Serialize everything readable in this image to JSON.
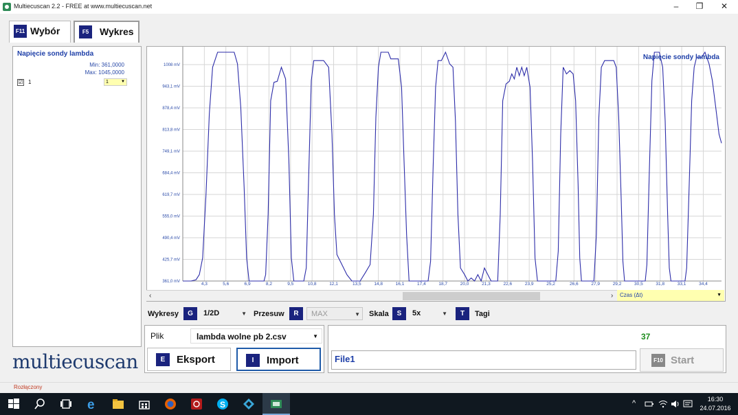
{
  "titlebar": {
    "title": "Multiecuscan 2.2 - FREE at www.multiecuscan.net",
    "minimize": "–",
    "maximize": "❐",
    "close": "✕"
  },
  "tabs": [
    {
      "key": "F11",
      "label": "Wybór"
    },
    {
      "key": "F5",
      "label": "Wykres"
    }
  ],
  "left_panel": {
    "title": "Napięcie sondy lambda",
    "min": "Min: 361,0000",
    "max": "Max: 1045,0000",
    "channel_checked": "☑",
    "channel_label": "1",
    "channel_select": "1"
  },
  "logo": "multiecuscan",
  "chart_data": {
    "type": "line",
    "title": "Napięcie sondy lambda",
    "y_ticks": [
      "361,0 mV",
      "425,7 mV",
      "490,4 mV",
      "555,0 mV",
      "619,7 mV",
      "684,4 mV",
      "749,1 mV",
      "813,8 mV",
      "878,4 mV",
      "943,1 mV",
      "1008 mV"
    ],
    "x_ticks": [
      "4,3",
      "5,6",
      "6,9",
      "8,2",
      "9,5",
      "10,8",
      "12,1",
      "13,5",
      "14,8",
      "16,1",
      "17,4",
      "18,7",
      "20,0",
      "21,3",
      "22,6",
      "23,9",
      "25,2",
      "26,6",
      "27,9",
      "29,2",
      "30,5",
      "31,8",
      "33,1",
      "34,4"
    ],
    "xlim": [
      3.0,
      35.5
    ],
    "ylim": [
      361,
      1008
    ],
    "grid": true,
    "series": [
      {
        "name": "Napięcie sondy lambda",
        "color": "#2b2ba8",
        "points": [
          [
            3.0,
            361
          ],
          [
            3.5,
            361
          ],
          [
            3.8,
            365
          ],
          [
            4.0,
            380
          ],
          [
            4.2,
            430
          ],
          [
            4.4,
            620
          ],
          [
            4.6,
            860
          ],
          [
            4.8,
            1000
          ],
          [
            5.1,
            1045
          ],
          [
            5.6,
            1045
          ],
          [
            6.1,
            1045
          ],
          [
            6.3,
            1010
          ],
          [
            6.5,
            880
          ],
          [
            6.7,
            640
          ],
          [
            6.85,
            430
          ],
          [
            7.0,
            361
          ],
          [
            7.5,
            361
          ],
          [
            7.9,
            361
          ],
          [
            8.0,
            380
          ],
          [
            8.15,
            560
          ],
          [
            8.3,
            900
          ],
          [
            8.5,
            955
          ],
          [
            8.7,
            958
          ],
          [
            8.95,
            1000
          ],
          [
            9.2,
            965
          ],
          [
            9.4,
            720
          ],
          [
            9.55,
            430
          ],
          [
            9.7,
            361
          ],
          [
            10.3,
            361
          ],
          [
            10.45,
            400
          ],
          [
            10.6,
            680
          ],
          [
            10.75,
            960
          ],
          [
            10.9,
            1020
          ],
          [
            11.5,
            1020
          ],
          [
            11.8,
            1000
          ],
          [
            12.0,
            800
          ],
          [
            12.15,
            560
          ],
          [
            12.3,
            440
          ],
          [
            12.6,
            410
          ],
          [
            12.9,
            380
          ],
          [
            13.2,
            361
          ],
          [
            13.7,
            361
          ],
          [
            14.0,
            385
          ],
          [
            14.3,
            410
          ],
          [
            14.5,
            560
          ],
          [
            14.65,
            850
          ],
          [
            14.8,
            1000
          ],
          [
            14.95,
            1045
          ],
          [
            15.4,
            1045
          ],
          [
            15.55,
            1025
          ],
          [
            16.0,
            1025
          ],
          [
            16.2,
            940
          ],
          [
            16.35,
            720
          ],
          [
            16.5,
            500
          ],
          [
            16.65,
            361
          ],
          [
            17.8,
            361
          ],
          [
            17.95,
            420
          ],
          [
            18.1,
            700
          ],
          [
            18.25,
            940
          ],
          [
            18.4,
            1020
          ],
          [
            18.6,
            1020
          ],
          [
            18.85,
            1045
          ],
          [
            19.1,
            1010
          ],
          [
            19.3,
            1000
          ],
          [
            19.45,
            840
          ],
          [
            19.6,
            560
          ],
          [
            19.75,
            400
          ],
          [
            20.0,
            380
          ],
          [
            20.2,
            361
          ],
          [
            20.4,
            370
          ],
          [
            20.6,
            361
          ],
          [
            20.8,
            380
          ],
          [
            21.0,
            361
          ],
          [
            21.2,
            400
          ],
          [
            21.4,
            380
          ],
          [
            21.6,
            361
          ],
          [
            22.0,
            361
          ],
          [
            22.15,
            560
          ],
          [
            22.3,
            900
          ],
          [
            22.5,
            950
          ],
          [
            22.7,
            958
          ],
          [
            22.85,
            980
          ],
          [
            23.0,
            965
          ],
          [
            23.15,
            1000
          ],
          [
            23.3,
            975
          ],
          [
            23.45,
            1000
          ],
          [
            23.6,
            975
          ],
          [
            23.75,
            1000
          ],
          [
            23.95,
            940
          ],
          [
            24.1,
            720
          ],
          [
            24.25,
            430
          ],
          [
            24.4,
            361
          ],
          [
            25.2,
            361
          ],
          [
            25.5,
            361
          ],
          [
            25.65,
            450
          ],
          [
            25.8,
            800
          ],
          [
            25.95,
            1000
          ],
          [
            26.15,
            980
          ],
          [
            26.35,
            990
          ],
          [
            26.55,
            980
          ],
          [
            26.7,
            900
          ],
          [
            26.85,
            650
          ],
          [
            26.95,
            430
          ],
          [
            27.05,
            361
          ],
          [
            27.8,
            361
          ],
          [
            27.95,
            500
          ],
          [
            28.1,
            850
          ],
          [
            28.25,
            1000
          ],
          [
            28.45,
            1020
          ],
          [
            29.0,
            1020
          ],
          [
            29.15,
            1000
          ],
          [
            29.3,
            850
          ],
          [
            29.45,
            600
          ],
          [
            29.55,
            420
          ],
          [
            29.65,
            361
          ],
          [
            30.5,
            361
          ],
          [
            30.9,
            361
          ],
          [
            31.0,
            410
          ],
          [
            31.15,
            700
          ],
          [
            31.3,
            960
          ],
          [
            31.45,
            1045
          ],
          [
            31.75,
            1045
          ],
          [
            31.95,
            1000
          ],
          [
            32.1,
            840
          ],
          [
            32.25,
            560
          ],
          [
            32.35,
            400
          ],
          [
            32.45,
            361
          ],
          [
            33.1,
            361
          ],
          [
            33.3,
            361
          ],
          [
            33.4,
            400
          ],
          [
            33.55,
            650
          ],
          [
            33.7,
            900
          ],
          [
            33.85,
            1000
          ],
          [
            34.0,
            1030
          ],
          [
            34.3,
            1030
          ],
          [
            34.5,
            1045
          ],
          [
            34.75,
            1010
          ],
          [
            34.95,
            960
          ],
          [
            35.15,
            880
          ],
          [
            35.35,
            800
          ],
          [
            35.5,
            773
          ]
        ]
      }
    ]
  },
  "scroll": {
    "left_arrow": "‹",
    "right_arrow": "›"
  },
  "time_select": "Czas (Δt)",
  "controls": {
    "wykresy_label": "Wykresy",
    "wykresy_key": "G",
    "wykresy_value": "1/2D",
    "przesuw_label": "Przesuw",
    "przesuw_key": "R",
    "przesuw_value": "MAX",
    "skala_label": "Skala",
    "skala_key": "S",
    "skala_value": "5x",
    "tagi_key": "T",
    "tagi_label": "Tagi"
  },
  "file": {
    "label": "Plik",
    "value": "lambda wolne pb 2.csv",
    "export_key": "E",
    "export_label": "Eksport",
    "import_key": "I",
    "import_label": "Import"
  },
  "right": {
    "count": "37",
    "file_name": "File1",
    "start_key": "F10",
    "start_label": "Start"
  },
  "status": "Rozłączony",
  "taskbar": {
    "time": "16:30",
    "date": "24.07.2016",
    "tray_chevron": "^"
  },
  "colors": {
    "accent_key": "#1a237e",
    "series_blue": "#2b2ba8",
    "status_red": "#c23b22",
    "count_green": "#1e8c1e"
  }
}
